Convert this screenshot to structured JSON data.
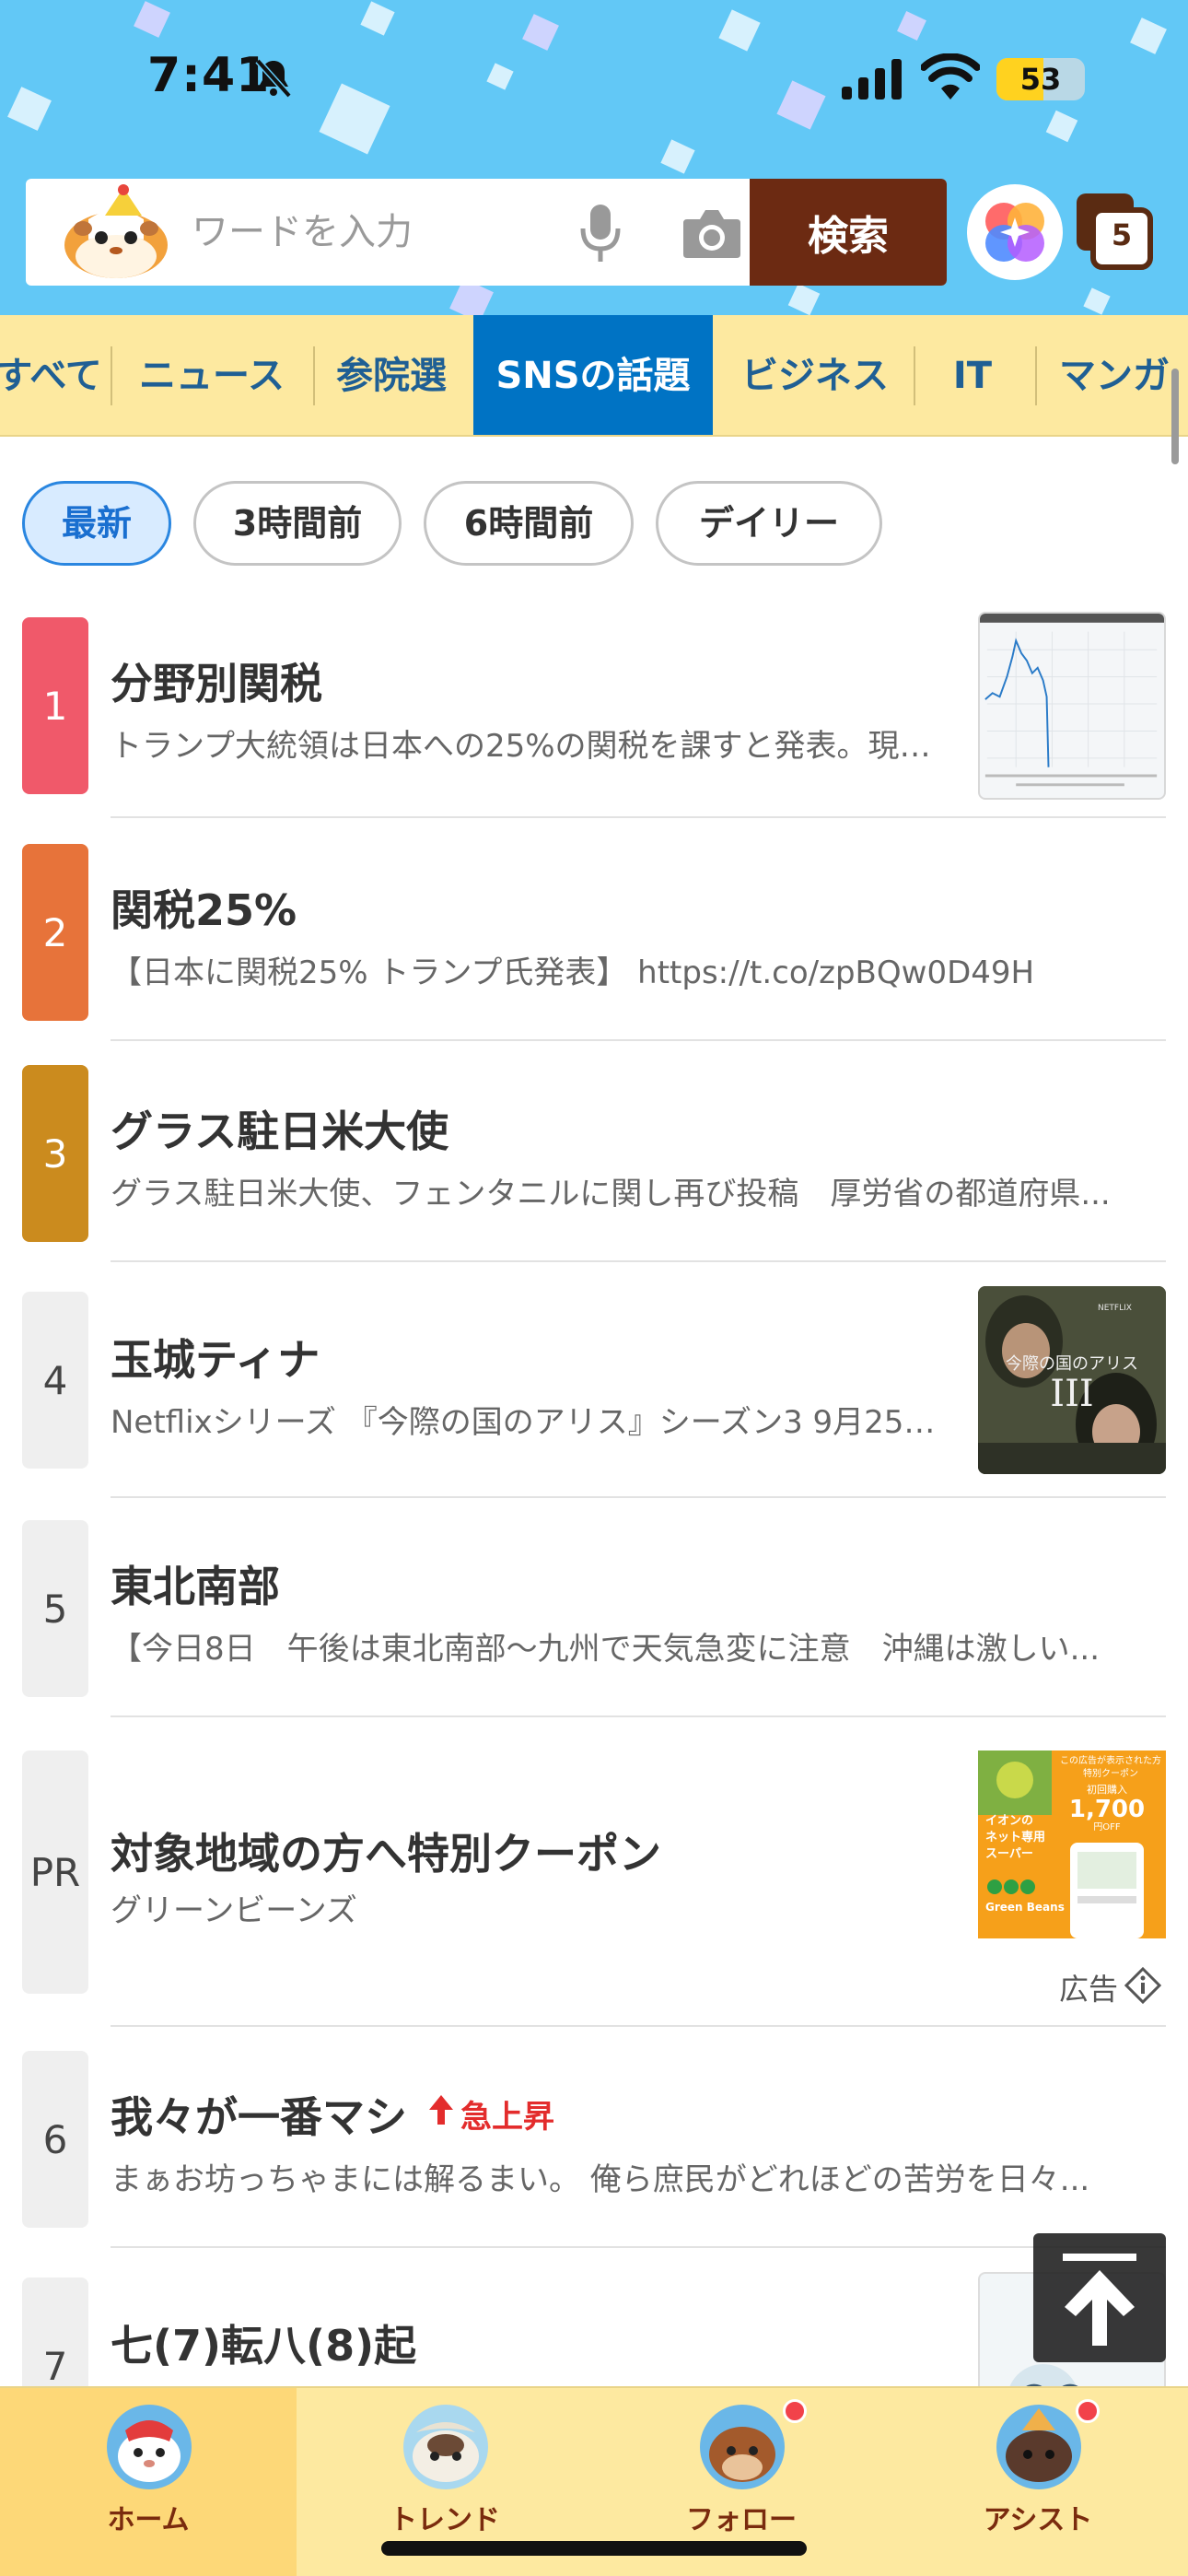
{
  "status_bar": {
    "time": "7:41",
    "battery": "53",
    "battery_level": 0.53
  },
  "search": {
    "placeholder": "ワードを入力",
    "button_label": "検索",
    "tab_count": "5"
  },
  "categories": [
    "すべて",
    "ニュース",
    "参院選",
    "SNSの話題",
    "ビジネス",
    "IT",
    "マンガ"
  ],
  "active_category": "SNSの話題",
  "filters": [
    "最新",
    "3時間前",
    "6時間前",
    "デイリー"
  ],
  "active_filter": "最新",
  "colors": {
    "rank1": "#f0596a",
    "rank2": "#e7733a",
    "rank3": "#cb8b1e",
    "tab_active": "#0073c4",
    "search_button": "#6c2a12",
    "rising": "#e32c2c"
  },
  "items": [
    {
      "rank": "1",
      "title": "分野別関税",
      "desc": "トランプ大統領は日本への25%の関税を課すと発表。現在...",
      "thumb": "stock-chart"
    },
    {
      "rank": "2",
      "title": "関税25%",
      "desc": "【日本に関税25% トランプ氏発表】 https://t.co/zpBQw0D49H"
    },
    {
      "rank": "3",
      "title": "グラス駐日米大使",
      "desc": "グラス駐日米大使、フェンタニルに関し再び投稿　厚労省の都道府県..."
    },
    {
      "rank": "4",
      "title": "玉城ティナ",
      "desc": "Netflixシリーズ 『今際の国のアリス』シーズン3 9月25日配信...",
      "thumb": "drama-poster",
      "poster_text": "今際の国のアリス",
      "poster_brand": "NETFLIX"
    },
    {
      "rank": "5",
      "title": "東北南部",
      "desc": "【今日8日　午後は東北南部〜九州で天気急変に注意　沖縄は激しい..."
    },
    {
      "rank": "PR",
      "title": "対象地域の方へ特別クーポン",
      "desc": "グリーンビーンズ",
      "thumb": "ad-banner",
      "ad_label": "広告",
      "banner_lines": [
        "この広告が表示された方",
        "特別クーポン",
        "初回購入",
        "1,700円OFF",
        "イオンのネット専用スーパー",
        "Green Beans"
      ]
    },
    {
      "rank": "6",
      "title": "我々が一番マシ",
      "desc": "まぁお坊っちゃまには解るまい。 俺ら庶民がどれほどの苦労を日々...",
      "badge": "急上昇"
    },
    {
      "rank": "7",
      "title": "七(7)転八(8)起",
      "desc": ""
    }
  ],
  "nav": [
    {
      "label": "ホーム",
      "active": true
    },
    {
      "label": "トレンド"
    },
    {
      "label": "フォロー",
      "dot": true
    },
    {
      "label": "アシスト",
      "dot": true
    }
  ]
}
